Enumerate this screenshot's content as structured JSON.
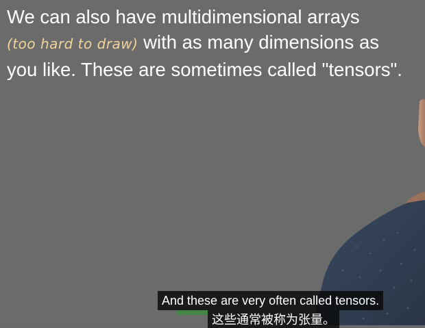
{
  "slide": {
    "line1": "We can also have multidimensional arrays",
    "handwritten_note": "(too hard to draw)",
    "line2_rest": " with as many dimensions as",
    "line3": "you like. These are sometimes called \"tensors\"."
  },
  "subtitles": {
    "english": "And these are very often called tensors.",
    "chinese": "这些通常被称为张量。"
  },
  "colors": {
    "background": "#6b6b6b",
    "slide_text": "#ffffff",
    "handwritten_note": "#f2d59a",
    "subtitle_bg": "#080808"
  }
}
